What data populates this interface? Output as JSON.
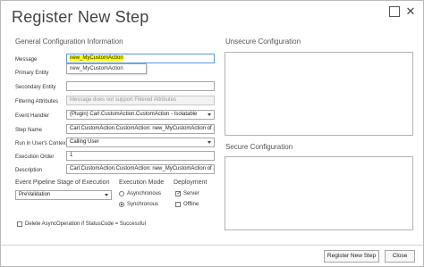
{
  "dialog": {
    "title": "Register New Step"
  },
  "general": {
    "section_title": "General Configuration Information",
    "fields": {
      "message": {
        "label": "Message",
        "value": "new_MyCustomAction",
        "suggestion": "new_MyCustomAction"
      },
      "primary_entity": {
        "label": "Primary Entity",
        "value": ""
      },
      "secondary_entity": {
        "label": "Secondary Entity",
        "value": ""
      },
      "filtering_attributes": {
        "label": "Filtering Attributes",
        "placeholder": "Message does not support Filtered Attributes"
      },
      "event_handler": {
        "label": "Event Handler",
        "value": "(Plugin) Carl.CustomAction.CustomAction - Isolatable"
      },
      "step_name": {
        "label": "Step Name",
        "value": "Carl.CustomAction.CustomAction: new_MyCustomAction of any En"
      },
      "run_context": {
        "label": "Run in User's Context",
        "value": "Calling User"
      },
      "execution_order": {
        "label": "Execution Order",
        "value": "1"
      },
      "description": {
        "label": "Description",
        "value": "Carl.CustomAction.CustomAction: new_MyCustomAction of any En"
      }
    }
  },
  "pipeline": {
    "heading": "Event Pipeline Stage of Execution",
    "value": "PreValidation"
  },
  "execution_mode": {
    "heading": "Execution Mode",
    "options": [
      {
        "label": "Asynchronous",
        "checked": false
      },
      {
        "label": "Synchronous",
        "checked": true
      }
    ]
  },
  "deployment": {
    "heading": "Deployment",
    "options": [
      {
        "label": "Server",
        "checked": true
      },
      {
        "label": "Offline",
        "checked": false
      }
    ]
  },
  "delete_async": {
    "label": "Delete AsyncOperation if StatusCode = Successful",
    "checked": false
  },
  "unsecure": {
    "heading": "Unsecure  Configuration"
  },
  "secure": {
    "heading": "Secure  Configuration"
  },
  "footer": {
    "register_label": "Register New Step",
    "close_label": "Close"
  },
  "icons": {
    "maximize": "maximize-icon",
    "close": "close-icon"
  }
}
